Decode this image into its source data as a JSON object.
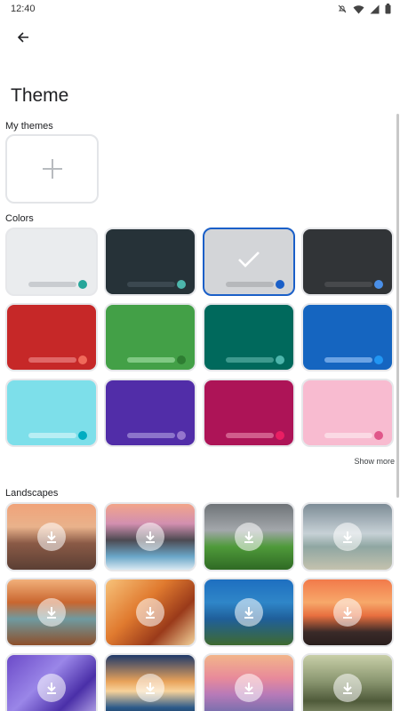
{
  "status": {
    "time": "12:40"
  },
  "header": {
    "title": "Theme"
  },
  "sections": {
    "my_themes": "My themes",
    "colors": "Colors",
    "landscapes": "Landscapes"
  },
  "colors": [
    {
      "name": "light",
      "bg": "#eaecee",
      "bar": "#c9ccd0",
      "dot": "#26a69a",
      "selected": false
    },
    {
      "name": "dark",
      "bg": "#263238",
      "bar": "#3b4850",
      "dot": "#4db6ac",
      "selected": false
    },
    {
      "name": "gray-light",
      "bg": "#d3d5d8",
      "bar": "#b6b8bb",
      "dot": "#1a5fc8",
      "selected": true
    },
    {
      "name": "gray-dark",
      "bg": "#313437",
      "bar": "#47494c",
      "dot": "#4a8fe8",
      "selected": false
    },
    {
      "name": "red",
      "bg": "#c62828",
      "bar": "#e06767",
      "dot": "#f06a5a",
      "selected": false
    },
    {
      "name": "green",
      "bg": "#43a047",
      "bar": "#80c983",
      "dot": "#2e7d32",
      "selected": false
    },
    {
      "name": "teal",
      "bg": "#00695c",
      "bar": "#3d9a8e",
      "dot": "#4db6ac",
      "selected": false
    },
    {
      "name": "blue",
      "bg": "#1565c0",
      "bar": "#6ba3e4",
      "dot": "#2196f3",
      "selected": false
    },
    {
      "name": "cyan",
      "bg": "#7ddfea",
      "bar": "#b8eef4",
      "dot": "#00acc1",
      "selected": false
    },
    {
      "name": "purple",
      "bg": "#512da8",
      "bar": "#8c74cb",
      "dot": "#9575cd",
      "selected": false
    },
    {
      "name": "magenta",
      "bg": "#ad1457",
      "bar": "#d15d8c",
      "dot": "#e91e63",
      "selected": false
    },
    {
      "name": "pink",
      "bg": "#f8bbd0",
      "bar": "#fbd9e4",
      "dot": "#e0578a",
      "selected": false
    }
  ],
  "show_more": "Show more",
  "landscapes": [
    {
      "name": "beach-sunset",
      "bg": "linear-gradient(180deg,#f0a37a 0%,#e9b28b 35%,#8a5a46 60%,#5b3f34 100%)"
    },
    {
      "name": "snowy-stream",
      "bg": "linear-gradient(180deg,#f2a58a 0%,#d28fb0 30%,#4d4a52 55%,#6aa6c8 80%,#d8e8f2 100%)"
    },
    {
      "name": "green-hills",
      "bg": "linear-gradient(180deg,#6f7478 0%,#a3a7ab 40%,#4f9a3a 65%,#2f6a24 100%)"
    },
    {
      "name": "calm-sea",
      "bg": "linear-gradient(180deg,#7d8c96 0%,#c7d1d6 45%,#8fa6a2 65%,#c4c2ae 100%)"
    },
    {
      "name": "horseshoe-bend",
      "bg": "linear-gradient(180deg,#f2b07a 0%,#c9662f 35%,#6f9aa0 60%,#8d4f2a 100%)"
    },
    {
      "name": "slot-canyon",
      "bg": "linear-gradient(135deg,#f7c27a 0%,#e07a2f 40%,#9a3a1a 70%,#f3d29a 100%)"
    },
    {
      "name": "coastal-cliffs",
      "bg": "linear-gradient(180deg,#1e6fc0 0%,#2f86c8 35%,#1f5f9a 60%,#3f6a2f 100%)"
    },
    {
      "name": "desert-sunset",
      "bg": "linear-gradient(180deg,#f27a4a 0%,#f7a86a 35%,#e86f3f 55%,#3a2a28 80%,#2a1f1e 100%)"
    },
    {
      "name": "purple-flowers",
      "bg": "linear-gradient(135deg,#6b4ac8 0%,#9a86e8 40%,#4a2fa8 70%,#c2b4f0 100%)"
    },
    {
      "name": "ocean-sunset",
      "bg": "linear-gradient(180deg,#1f3a6a 0%,#e8a25a 40%,#f7d29a 55%,#2c5a8a 80%,#162a4a 100%)"
    },
    {
      "name": "mountain-dusk",
      "bg": "linear-gradient(180deg,#f2b58a 0%,#e88a9a 35%,#b77ab8 60%,#5a6aa8 100%)"
    },
    {
      "name": "water-ripples",
      "bg": "linear-gradient(180deg,#c8cfa8 0%,#8a9670 40%,#4f5a3a 70%,#9aa480 100%)"
    }
  ]
}
